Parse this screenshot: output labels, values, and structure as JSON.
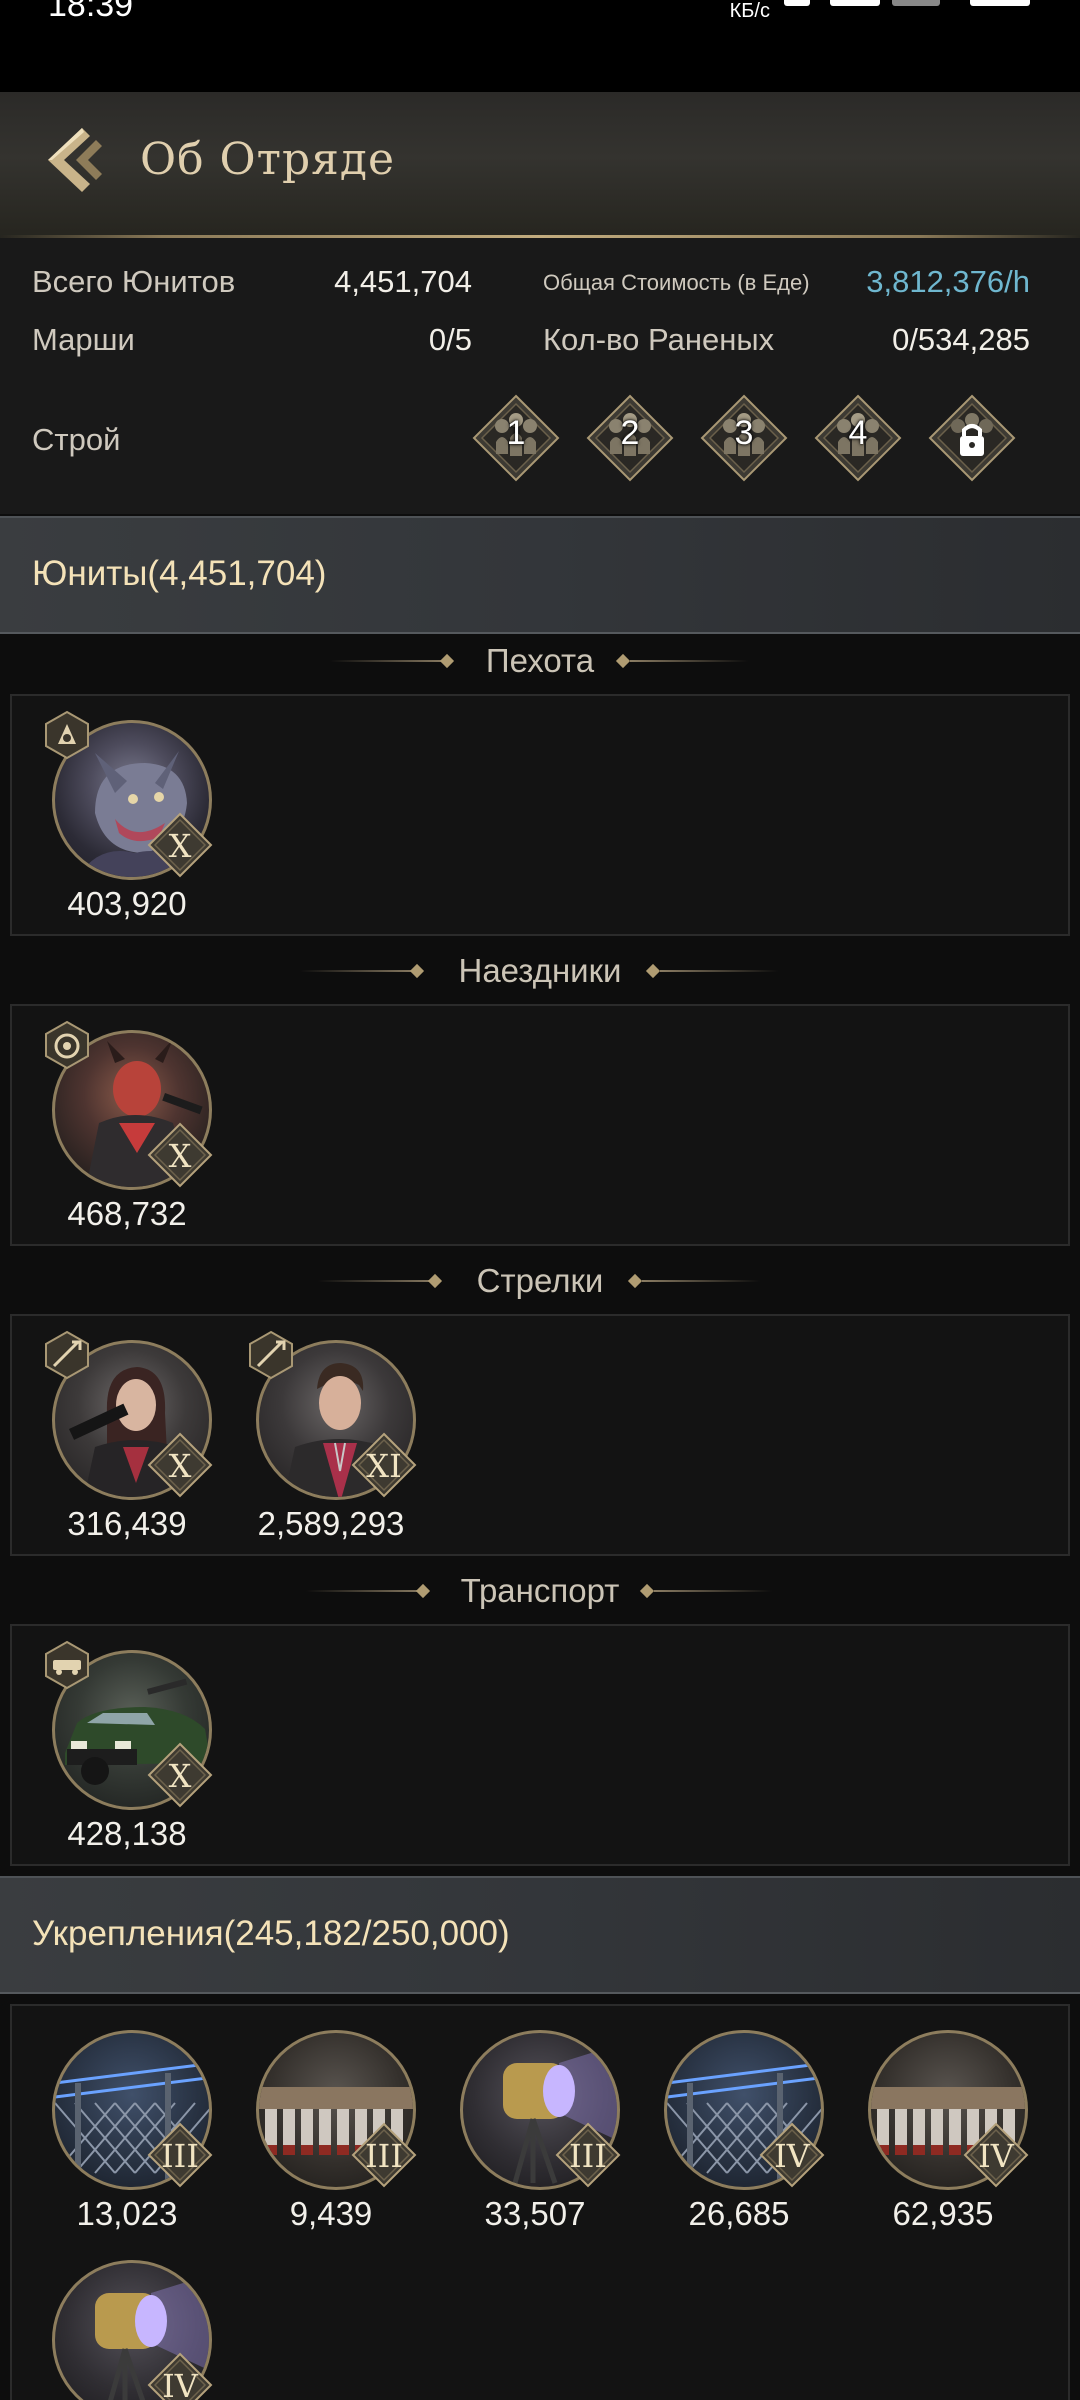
{
  "status": {
    "time": "18:39",
    "net": "КБ/с"
  },
  "header": {
    "title": "Об Отряде"
  },
  "stats": {
    "total_units_label": "Всего Юнитов",
    "total_units_value": "4,451,704",
    "cost_label": "Общая Стоимость (в Еде)",
    "cost_value": "3,812,376/h",
    "marches_label": "Марши",
    "marches_value": "0/5",
    "wounded_label": "Кол-во Раненых",
    "wounded_value": "0/534,285",
    "formation_label": "Строй",
    "formations": [
      "1",
      "2",
      "3",
      "4",
      ""
    ]
  },
  "units_section": {
    "label": "Юниты(4,451,704)"
  },
  "categories": {
    "infantry": {
      "title": "Пехота",
      "units": [
        {
          "count": "403,920",
          "tier": "X",
          "portrait": "werewolf"
        }
      ]
    },
    "riders": {
      "title": "Наездники",
      "units": [
        {
          "count": "468,732",
          "tier": "X",
          "portrait": "red-demon-biker"
        }
      ]
    },
    "shooters": {
      "title": "Стрелки",
      "units": [
        {
          "count": "316,439",
          "tier": "X",
          "portrait": "woman-gunner"
        },
        {
          "count": "2,589,293",
          "tier": "XI",
          "portrait": "man-leather-jacket"
        }
      ]
    },
    "transport": {
      "title": "Транспорт",
      "units": [
        {
          "count": "428,138",
          "tier": "X",
          "portrait": "armored-suv"
        }
      ]
    }
  },
  "fortifications": {
    "label": "Укрепления(245,182/250,000)",
    "items": [
      {
        "count": "13,023",
        "tier": "III",
        "kind": "electric-fence"
      },
      {
        "count": "9,439",
        "tier": "III",
        "kind": "spike-barricade"
      },
      {
        "count": "33,507",
        "tier": "III",
        "kind": "searchlight"
      },
      {
        "count": "26,685",
        "tier": "IV",
        "kind": "electric-fence"
      },
      {
        "count": "62,935",
        "tier": "IV",
        "kind": "spike-barricade"
      },
      {
        "count": "",
        "tier": "IV",
        "kind": "searchlight"
      }
    ]
  },
  "colors": {
    "accent_gold": "#e0cfae",
    "cyan_value": "#6fb7cf",
    "section_label": "#f4e2b8"
  }
}
